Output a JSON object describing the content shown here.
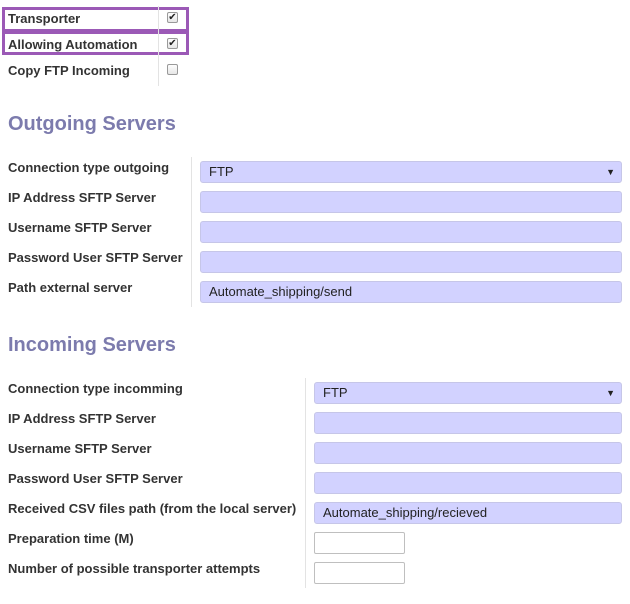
{
  "top_flags": {
    "transporter": {
      "label": "Transporter",
      "checked": true
    },
    "allowing_automation": {
      "label": "Allowing Automation",
      "checked": true
    },
    "copy_ftp_incoming": {
      "label": "Copy FTP Incoming",
      "checked": false
    },
    "highlight_color": "#9b59b6"
  },
  "outgoing": {
    "title": "Outgoing Servers",
    "connection_type": {
      "label": "Connection type outgoing",
      "value": "FTP"
    },
    "ip_address": {
      "label": "IP Address SFTP Server",
      "value": ""
    },
    "username": {
      "label": "Username SFTP Server",
      "value": ""
    },
    "password": {
      "label": "Password User SFTP Server",
      "value": ""
    },
    "path": {
      "label": "Path external server",
      "value": "Automate_shipping/send"
    }
  },
  "incoming": {
    "title": "Incoming Servers",
    "connection_type": {
      "label": "Connection type incomming",
      "value": "FTP"
    },
    "ip_address": {
      "label": "IP Address SFTP Server",
      "value": ""
    },
    "username": {
      "label": "Username SFTP Server",
      "value": ""
    },
    "password": {
      "label": "Password User SFTP Server",
      "value": ""
    },
    "csv_path": {
      "label": "Received CSV files path (from the local server)",
      "value": "Automate_shipping/recieved"
    },
    "preparation_time": {
      "label": "Preparation time (M)",
      "value": ""
    },
    "attempts": {
      "label": "Number of possible transporter attempts",
      "value": ""
    }
  },
  "colors": {
    "section_title": "#7c7bad",
    "required_field": "#d2d2ff"
  },
  "icons": {
    "dropdown": "caret-down-icon",
    "check": "check-icon"
  }
}
